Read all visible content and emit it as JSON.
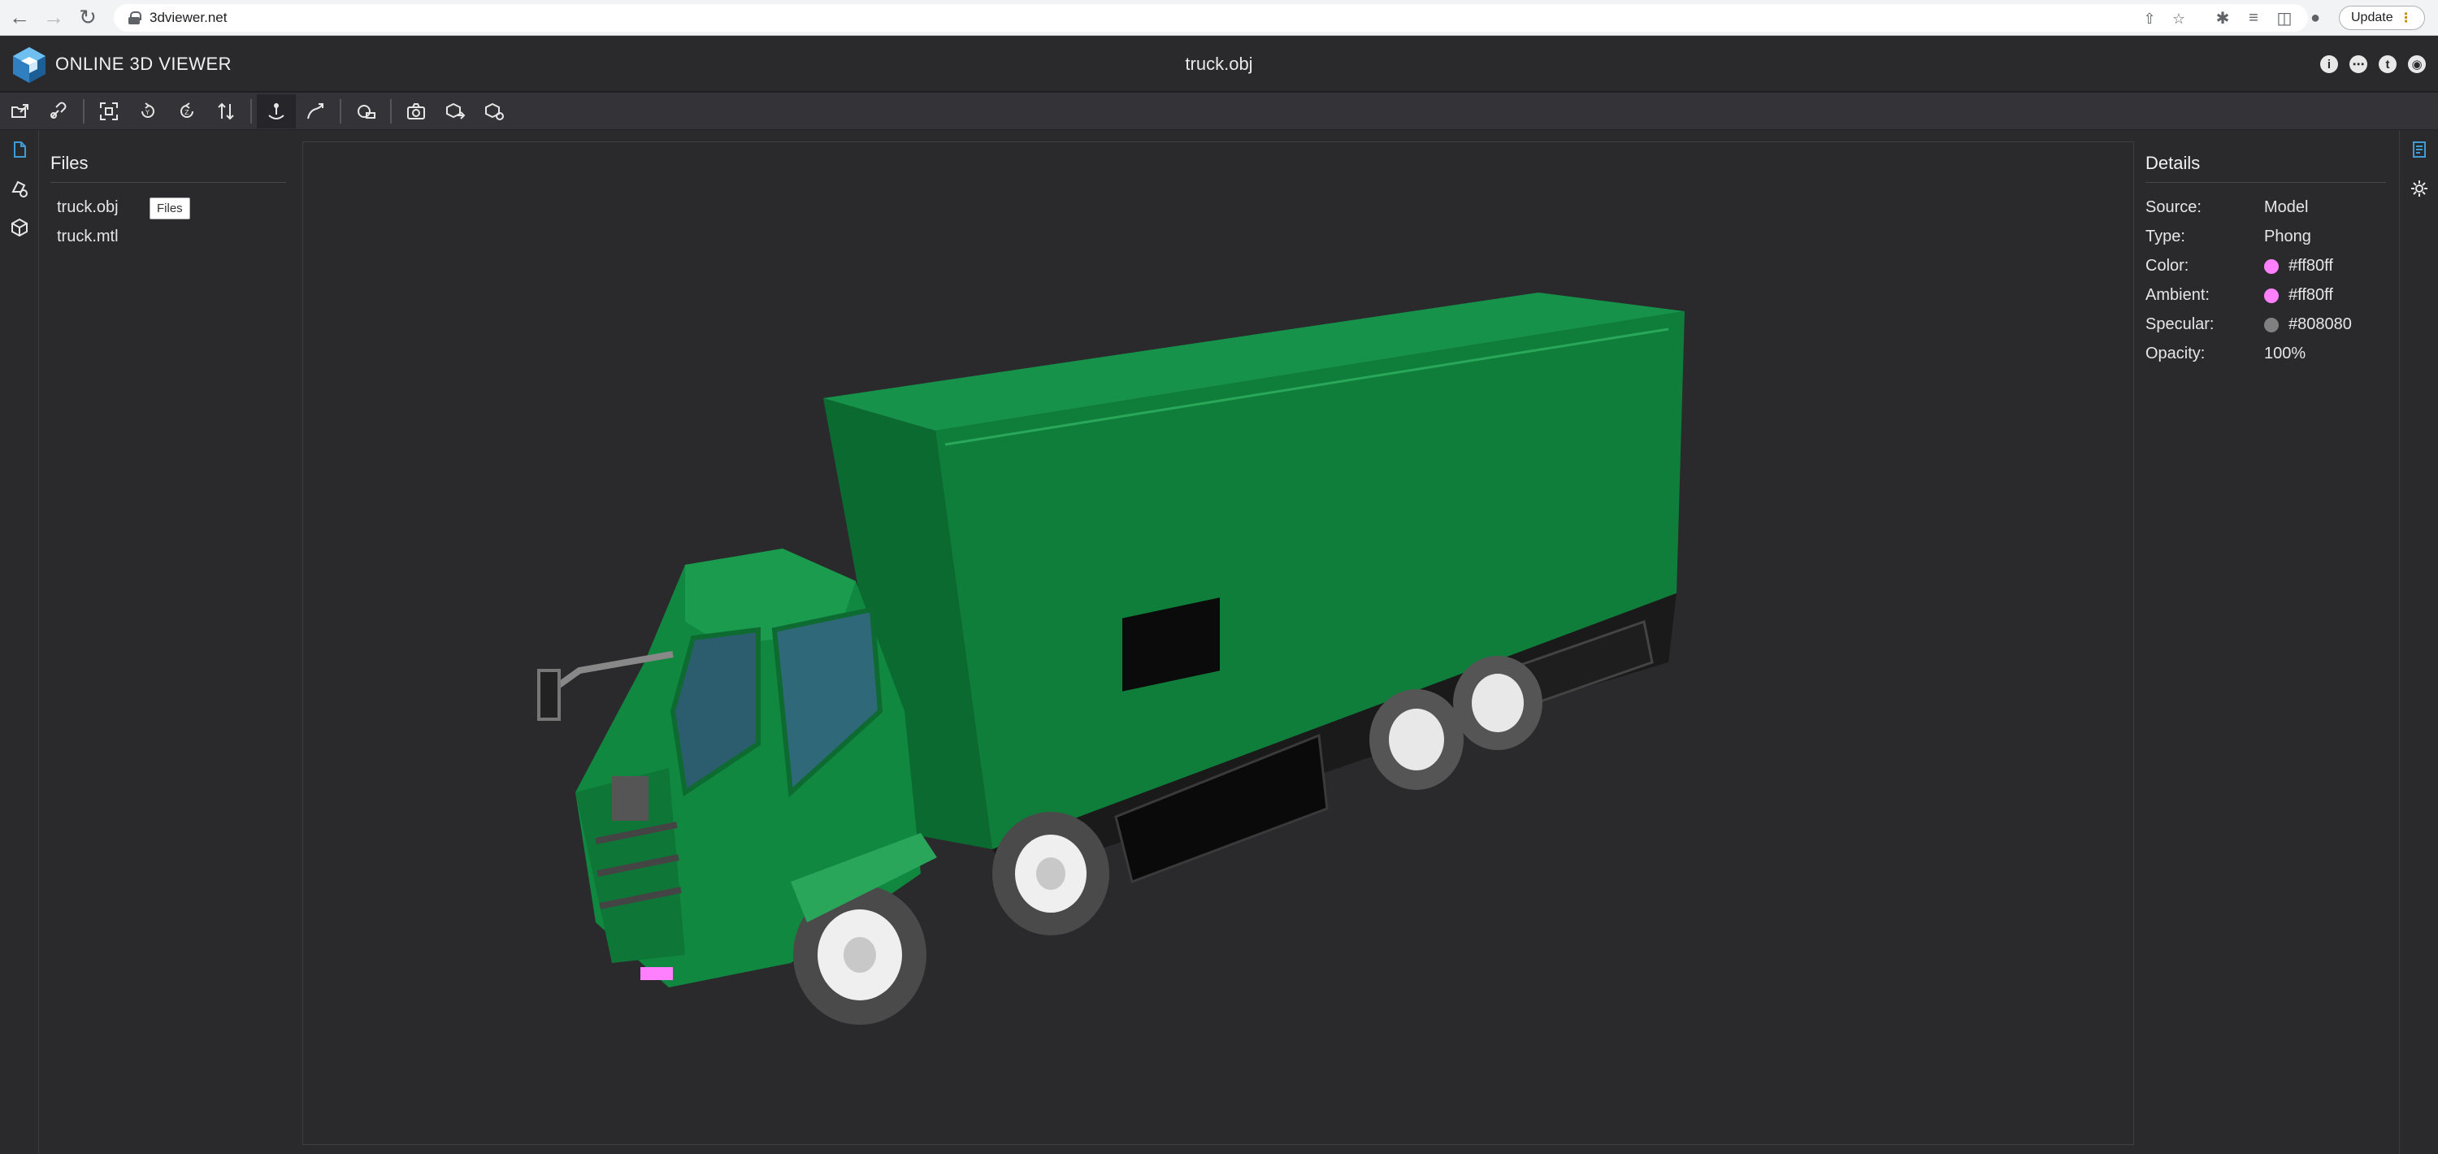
{
  "browser": {
    "url": "3dviewer.net",
    "update_label": "Update"
  },
  "app": {
    "title": "ONLINE 3D VIEWER",
    "file_title": "truck.obj"
  },
  "toolbar": {
    "buttons": [
      "open-file",
      "open-url",
      "fit-to-window",
      "rotate-left",
      "rotate-right",
      "flip-up",
      "fixed-up-vector",
      "free-orbit",
      "measure",
      "snapshot",
      "export",
      "share"
    ]
  },
  "files_panel": {
    "title": "Files",
    "files": [
      "truck.obj",
      "truck.mtl"
    ],
    "tooltip": "Files"
  },
  "details_panel": {
    "title": "Details",
    "properties": [
      {
        "label": "Source:",
        "value": "Model"
      },
      {
        "label": "Type:",
        "value": "Phong"
      },
      {
        "label": "Color:",
        "value": "#ff80ff",
        "swatch": "#ff80ff"
      },
      {
        "label": "Ambient:",
        "value": "#ff80ff",
        "swatch": "#ff80ff"
      },
      {
        "label": "Specular:",
        "value": "#808080",
        "swatch": "#808080"
      },
      {
        "label": "Opacity:",
        "value": "100%"
      }
    ]
  },
  "colors": {
    "background": "#2a2a2d",
    "accent": "#3d9bd6",
    "truck_body": "#12873f"
  }
}
